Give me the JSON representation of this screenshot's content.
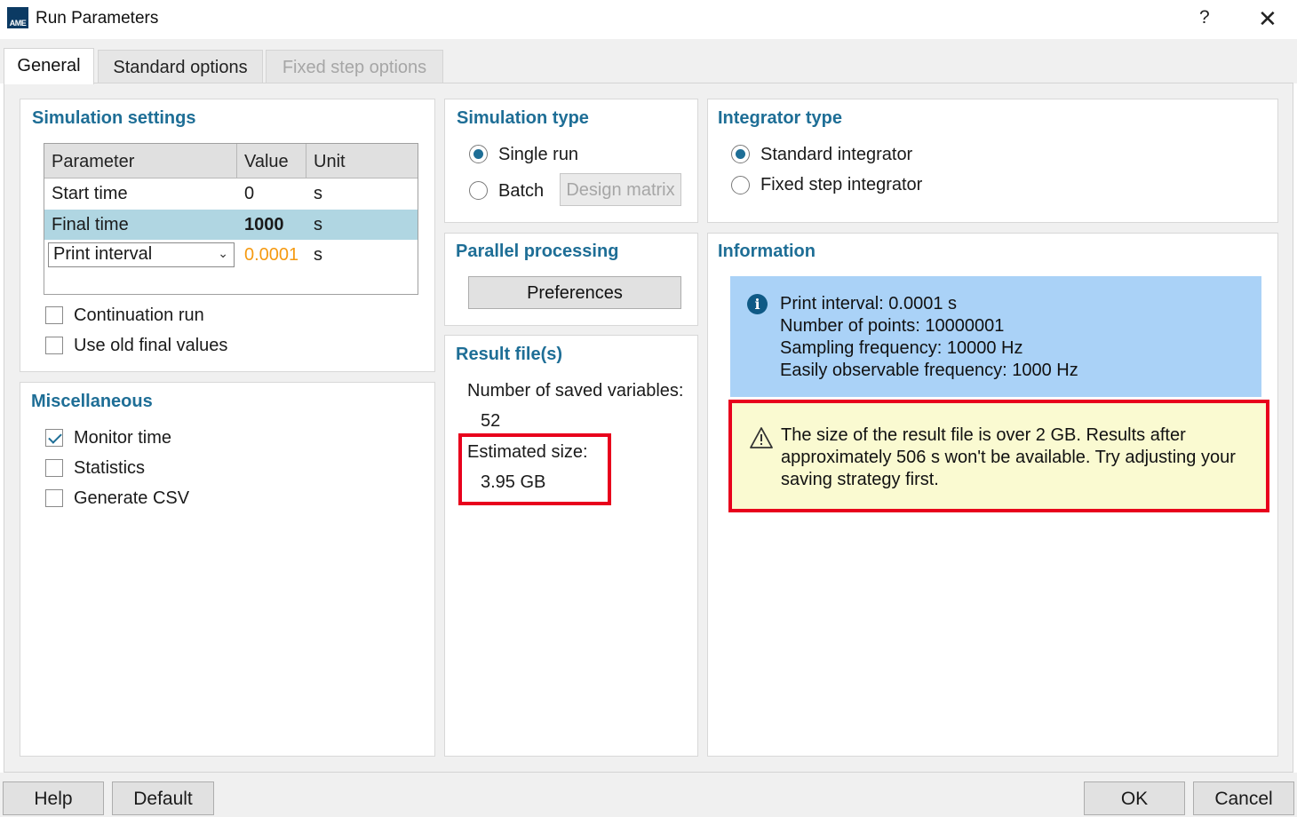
{
  "window": {
    "icon_text": "AME",
    "title": "Run Parameters",
    "help_glyph": "?",
    "close_glyph": "✕"
  },
  "tabs": [
    {
      "label": "General",
      "active": true
    },
    {
      "label": "Standard options",
      "active": false
    },
    {
      "label": "Fixed step options",
      "active": false,
      "disabled": true
    }
  ],
  "simulation_settings": {
    "title": "Simulation settings",
    "columns": [
      "Parameter",
      "Value",
      "Unit"
    ],
    "rows": [
      {
        "parameter": "Start time",
        "value": "0",
        "unit": "s"
      },
      {
        "parameter": "Final time",
        "value": "1000",
        "unit": "s",
        "selected": true
      },
      {
        "parameter": "Print interval",
        "value": "0.0001",
        "unit": "s",
        "dropdown": true
      }
    ],
    "continuation_run": {
      "label": "Continuation run",
      "checked": false
    },
    "use_old_final_values": {
      "label": "Use old final values",
      "checked": false
    }
  },
  "miscellaneous": {
    "title": "Miscellaneous",
    "monitor_time": {
      "label": "Monitor time",
      "checked": true
    },
    "statistics": {
      "label": "Statistics",
      "checked": false
    },
    "generate_csv": {
      "label": "Generate CSV",
      "checked": false
    }
  },
  "simulation_type": {
    "title": "Simulation type",
    "single_run": {
      "label": "Single run",
      "selected": true
    },
    "batch": {
      "label": "Batch",
      "selected": false
    },
    "design_matrix_label": "Design matrix"
  },
  "parallel_processing": {
    "title": "Parallel processing",
    "preferences_label": "Preferences"
  },
  "result_files": {
    "title": "Result file(s)",
    "saved_vars_label": "Number of saved variables:",
    "saved_vars_value": "52",
    "estimated_size_label": "Estimated size:",
    "estimated_size_value": "3.95 GB"
  },
  "integrator_type": {
    "title": "Integrator type",
    "standard": {
      "label": "Standard integrator",
      "selected": true
    },
    "fixed_step": {
      "label": "Fixed step integrator",
      "selected": false
    }
  },
  "information": {
    "title": "Information",
    "info_lines": [
      "Print interval: 0.0001 s",
      "Number of points: 10000001",
      "Sampling frequency: 10000 Hz",
      "Easily observable frequency: 1000 Hz"
    ],
    "warning_lines": [
      "The size of the result file is over 2 GB. Results after",
      "approximately 506 s won't be available. Try adjusting your",
      "saving strategy first."
    ]
  },
  "footer": {
    "help_label": "Help",
    "default_label": "Default",
    "ok_label": "OK",
    "cancel_label": "Cancel"
  },
  "colors": {
    "accent_title": "#1e6e96",
    "selected_row": "#b0d6e2",
    "info_bg": "#aad2f7",
    "warning_bg": "#fafad1",
    "highlight_border": "#e8001c",
    "orange_value": "#f59a12"
  }
}
